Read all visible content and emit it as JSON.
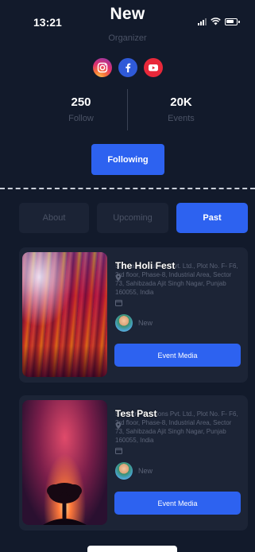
{
  "status_bar": {
    "time": "13:21"
  },
  "header": {
    "title": "New",
    "subtitle": "Organizer"
  },
  "socials": [
    {
      "icon": "instagram-icon",
      "color": "#e1306c"
    },
    {
      "icon": "facebook-icon",
      "color": "#2f5ad8"
    },
    {
      "icon": "youtube-icon",
      "color": "#e8283a"
    }
  ],
  "stats": {
    "follow_count": "250",
    "follow_label": "Follow",
    "events_count": "20K",
    "events_label": "Events"
  },
  "follow_button": {
    "label": "Following"
  },
  "tabs": [
    {
      "label": "About",
      "active": false
    },
    {
      "label": "Upcoming",
      "active": false
    },
    {
      "label": "Past",
      "active": true
    }
  ],
  "events": [
    {
      "title": "The Holi Fest",
      "location": "Software Solutions Pvt. Ltd., Plot No. F- F6, 3rd floor, Phase-8, Industrial Area, Sector 73, Sahibzada Ajit Singh Nagar, Punjab 160055, India",
      "organizer": "New",
      "button_label": "Event Media"
    },
    {
      "title": "Test Past",
      "location": "Software Solutions Pvt. Ltd., Plot No. F- F6, 3rd floor, Phase-8, Industrial Area, Sector 73, Sahibzada Ajit Singh Nagar, Punjab 160055, India",
      "organizer": "New",
      "button_label": "Event Media"
    }
  ],
  "colors": {
    "background": "#121a2b",
    "accent": "#2d62f0",
    "card": "#1c2436",
    "muted": "#4b5366"
  }
}
